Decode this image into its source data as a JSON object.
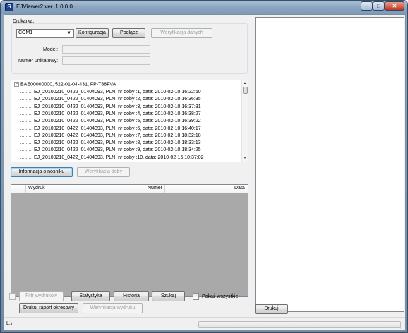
{
  "window": {
    "title": "EJViewer2 ver. 1.0.0.0",
    "app_icon": "S",
    "minimize": "–",
    "maximize": "□",
    "close": "✕"
  },
  "printer": {
    "group_label": "Drukarka:",
    "port_value": "COM1",
    "configure_label": "Konfiguracja",
    "connect_label": "Podłącz",
    "verify_data_label": "Weryfikacja danych",
    "model_label": "Model:",
    "model_value": "",
    "serial_label": "Numer unikatowy:",
    "serial_value": ""
  },
  "tree": {
    "root": "BAE00000000, 522-01-04-431, FP-T88FVA",
    "root_expander": "−",
    "items": [
      "EJ_20100210_0422_01404093, PLN, nr doby :1, data: 2010-02-10 16:22:50",
      "EJ_20100210_0422_01404093, PLN, nr doby :2, data: 2010-02-10 16:36:35",
      "EJ_20100210_0422_01404093, PLN, nr doby :3, data: 2010-02-10 16:37:31",
      "EJ_20100210_0422_01404093, PLN, nr doby :4, data: 2010-02-10 16:38:27",
      "EJ_20100210_0422_01404093, PLN, nr doby :5, data: 2010-02-10 16:39:22",
      "EJ_20100210_0422_01404093, PLN, nr doby :6, data: 2010-02-10 16:40:17",
      "EJ_20100210_0422_01404093, PLN, nr doby :7, data: 2010-02-10 18:32:18",
      "EJ_20100210_0422_01404093, PLN, nr doby :8, data: 2010-02-10 18:33:13",
      "EJ_20100210_0422_01404093, PLN, nr doby :9, data: 2010-02-10 18:34:25",
      "EJ_20100210_0422_01404093, PLN, nr doby :10, data: 2010-02-15 10:37:02"
    ]
  },
  "medium": {
    "info_label": "Informacja o nośniku",
    "verify_day_label": "Weryfikacja doby"
  },
  "printouts": {
    "columns": [
      "Wydruk",
      "Numer",
      "Data"
    ]
  },
  "filters": {
    "filter_label": "Filtr wydruków",
    "stats_label": "Statystyka",
    "history_label": "Historia",
    "search_label": "Szukaj",
    "show_all_label": "Pokaż wszystkie",
    "periodic_label": "Drukuj raport okresowy",
    "verify_print_label": "Weryfikacja wydruku",
    "print_label": "Drukuj"
  },
  "status": {
    "path": "L:\\"
  }
}
